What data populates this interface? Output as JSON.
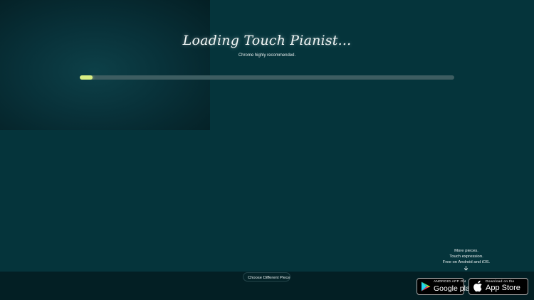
{
  "loader": {
    "title": "Loading Touch Pianist...",
    "subtitle": "Chrome highly recommended.",
    "progress_fraction": 0.035
  },
  "bottom_bar": {
    "choose_button_label": "Choose Different Piece"
  },
  "promo": {
    "line1": "More pieces.",
    "line2": "Touch expression.",
    "line3": "Free on Android and iOS.",
    "arrow_icon": "down-arrow-icon"
  },
  "badges": {
    "google": {
      "top": "ANDROID APP ON",
      "bottom": "Google play",
      "icon": "google-play-icon"
    },
    "apple": {
      "top": "Download on the",
      "bottom": "App Store",
      "icon": "apple-icon"
    }
  },
  "colors": {
    "background": "#05343b",
    "progress": "#d9ee84",
    "bottom_bar": "#031f24"
  }
}
